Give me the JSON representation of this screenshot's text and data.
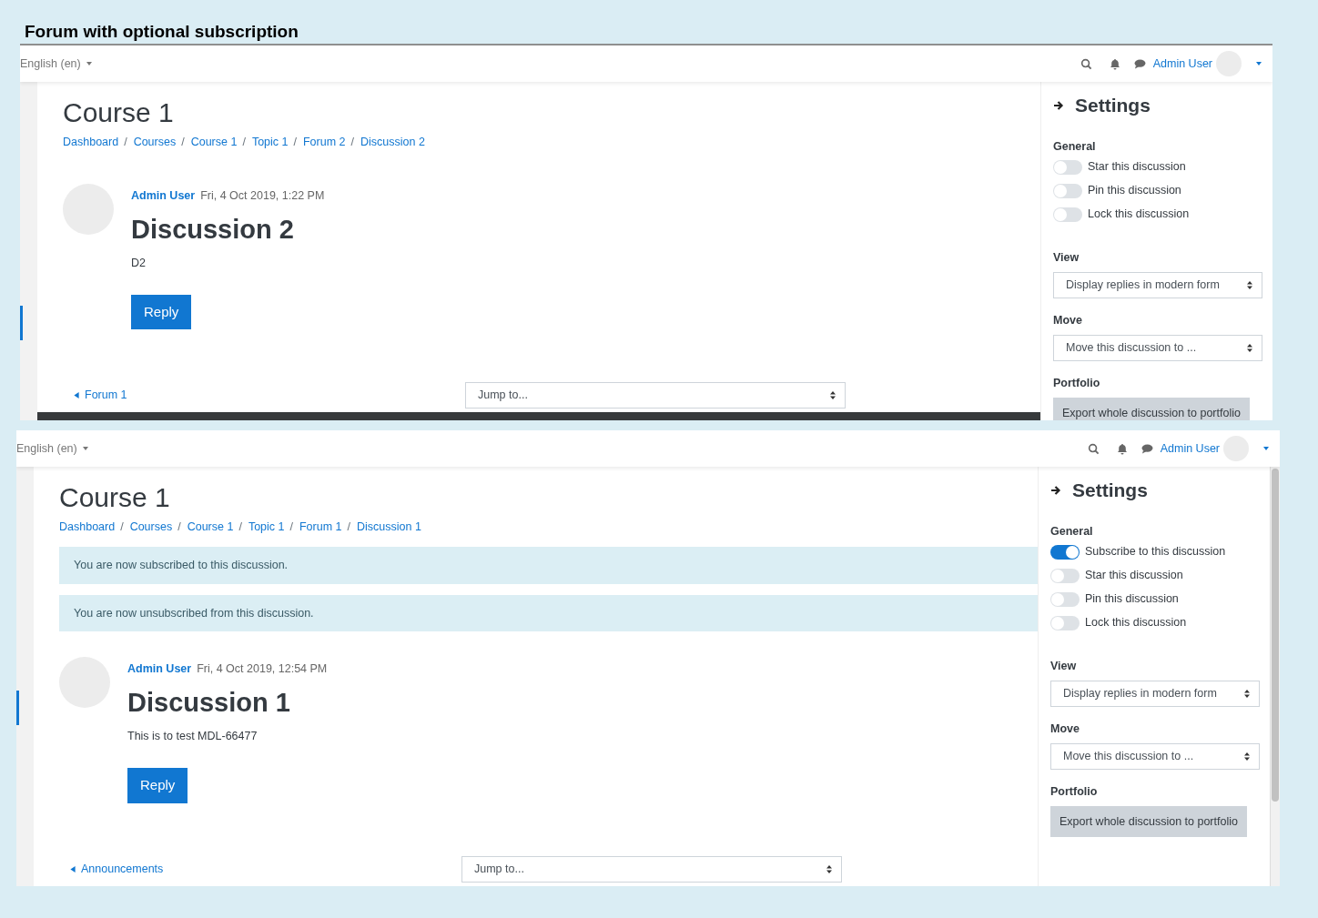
{
  "title": "Forum with optional subscription",
  "screens": [
    {
      "navbar": {
        "language": "English (en)",
        "user": "Admin User"
      },
      "page": {
        "heading": "Course 1",
        "breadcrumb_separator": "/",
        "breadcrumbs": [
          "Dashboard",
          "Courses",
          "Course 1",
          "Topic 1",
          "Forum 2",
          "Discussion 2"
        ],
        "post": {
          "author": "Admin User",
          "date": "Fri, 4 Oct 2019, 1:22 PM",
          "title": "Discussion 2",
          "body": "D2",
          "reply": "Reply"
        },
        "prev_link": "Forum 1",
        "jump_to": "Jump to..."
      },
      "settings": {
        "heading": "Settings",
        "general_label": "General",
        "toggles": [
          {
            "label": "Star this discussion",
            "on": false
          },
          {
            "label": "Pin this discussion",
            "on": false
          },
          {
            "label": "Lock this discussion",
            "on": false
          }
        ],
        "view_label": "View",
        "view_select": "Display replies in modern form",
        "move_label": "Move",
        "move_select": "Move this discussion to ...",
        "portfolio_label": "Portfolio",
        "export_button": "Export whole discussion to portfolio"
      }
    },
    {
      "navbar": {
        "language": "English (en)",
        "user": "Admin User"
      },
      "page": {
        "heading": "Course 1",
        "breadcrumb_separator": "/",
        "breadcrumbs": [
          "Dashboard",
          "Courses",
          "Course 1",
          "Topic 1",
          "Forum 1",
          "Discussion 1"
        ],
        "notices": [
          "You are now subscribed to this discussion.",
          "You are now unsubscribed from this discussion."
        ],
        "post": {
          "author": "Admin User",
          "date": "Fri, 4 Oct 2019, 12:54 PM",
          "title": "Discussion 1",
          "body": "This is to test MDL-66477",
          "reply": "Reply"
        },
        "prev_link": "Announcements",
        "jump_to": "Jump to..."
      },
      "settings": {
        "heading": "Settings",
        "general_label": "General",
        "toggles": [
          {
            "label": "Subscribe to this discussion",
            "on": true
          },
          {
            "label": "Star this discussion",
            "on": false
          },
          {
            "label": "Pin this discussion",
            "on": false
          },
          {
            "label": "Lock this discussion",
            "on": false
          }
        ],
        "view_label": "View",
        "view_select": "Display replies in modern form",
        "move_label": "Move",
        "move_select": "Move this discussion to ...",
        "portfolio_label": "Portfolio",
        "export_button": "Export whole discussion to portfolio"
      }
    }
  ]
}
